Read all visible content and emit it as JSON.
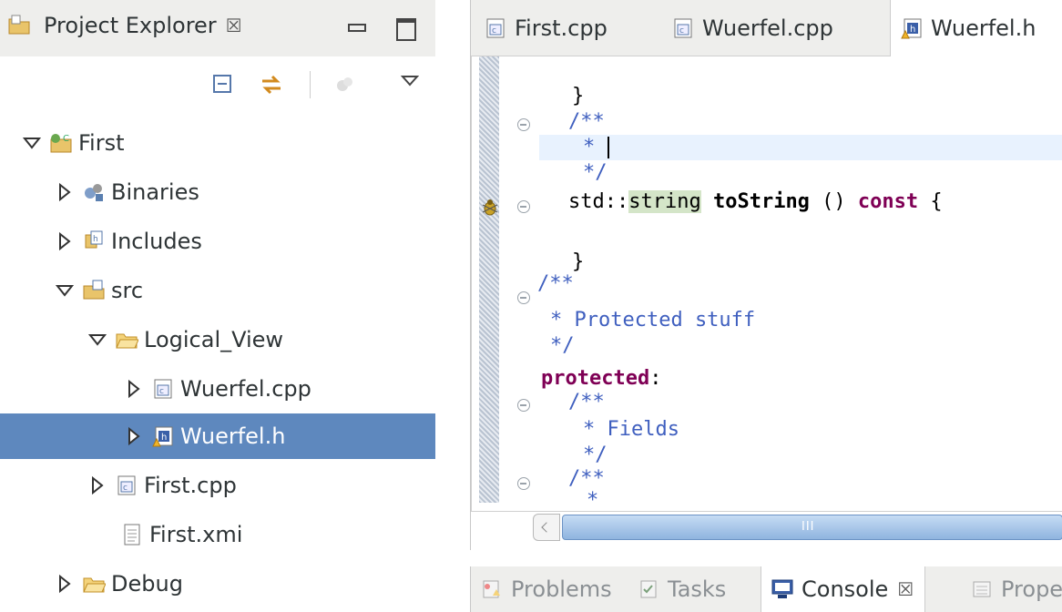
{
  "project_explorer": {
    "title": "Project Explorer",
    "close_glyph": "☒",
    "toolbar": [
      "collapse-all-icon",
      "link-with-editor-icon",
      "filter-icon",
      "view-menu-icon"
    ],
    "tree": [
      {
        "label": "First",
        "icon": "cpp-project-icon",
        "expanded": true
      },
      {
        "label": "Binaries",
        "icon": "binaries-icon",
        "expanded": false
      },
      {
        "label": "Includes",
        "icon": "includes-icon",
        "expanded": false
      },
      {
        "label": "src",
        "icon": "source-folder-icon",
        "expanded": true
      },
      {
        "label": "Logical_View",
        "icon": "folder-icon",
        "expanded": true
      },
      {
        "label": "Wuerfel.cpp",
        "icon": "cpp-file-icon",
        "expanded": false
      },
      {
        "label": "Wuerfel.h",
        "icon": "header-file-icon",
        "expanded": false,
        "selected": true
      },
      {
        "label": "First.cpp",
        "icon": "cpp-file-icon",
        "expanded": false
      },
      {
        "label": "First.xmi",
        "icon": "text-file-icon"
      },
      {
        "label": "Debug",
        "icon": "folder-icon",
        "expanded": false
      }
    ]
  },
  "editor": {
    "tabs": [
      {
        "label": "First.cpp",
        "icon": "cpp-file-icon"
      },
      {
        "label": "Wuerfel.cpp",
        "icon": "cpp-file-icon"
      },
      {
        "label": "Wuerfel.h",
        "icon": "header-file-icon",
        "active": true
      }
    ],
    "code": {
      "l0": "}",
      "l1": "/**",
      "l2": "* ",
      "l3": "*/",
      "l4_ns": "std::",
      "l4_type": "string",
      "l4_fn": "toString",
      "l4_parens": " () ",
      "l4_kw": "const",
      "l4_brace": " {",
      "l6": "}",
      "l7": "/**",
      "l8": "* Protected stuff",
      "l9": "*/",
      "l10_kw": "protected",
      "l10_colon": ":",
      "l11": "/**",
      "l12": "* Fields",
      "l13": "*/",
      "l14": "/**",
      "l15": "*"
    },
    "scrollbar_grip": "III"
  },
  "bottom_panel": {
    "tabs": [
      {
        "label": "Problems",
        "icon": "problems-icon"
      },
      {
        "label": "Tasks",
        "icon": "tasks-icon"
      },
      {
        "label": "Console",
        "icon": "console-icon",
        "active": true,
        "close_glyph": "☒"
      },
      {
        "label": "Prope",
        "icon": "properties-icon"
      }
    ]
  },
  "colors": {
    "selection": "#5e88be",
    "comment": "#3f5fbf",
    "keyword": "#7f0055",
    "current_line": "#e8f2fe"
  }
}
